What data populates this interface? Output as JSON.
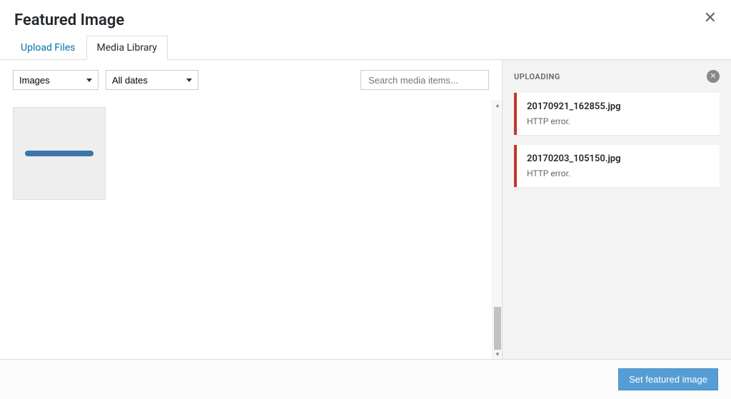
{
  "modal": {
    "title": "Featured Image"
  },
  "tabs": {
    "upload": "Upload Files",
    "library": "Media Library"
  },
  "filters": {
    "type": "Images",
    "date": "All dates"
  },
  "search": {
    "placeholder": "Search media items..."
  },
  "sidebar": {
    "title": "UPLOADING",
    "uploads": [
      {
        "filename": "20170921_162855.jpg",
        "error": "HTTP error."
      },
      {
        "filename": "20170203_105150.jpg",
        "error": "HTTP error."
      }
    ]
  },
  "footer": {
    "submit": "Set featured image"
  }
}
